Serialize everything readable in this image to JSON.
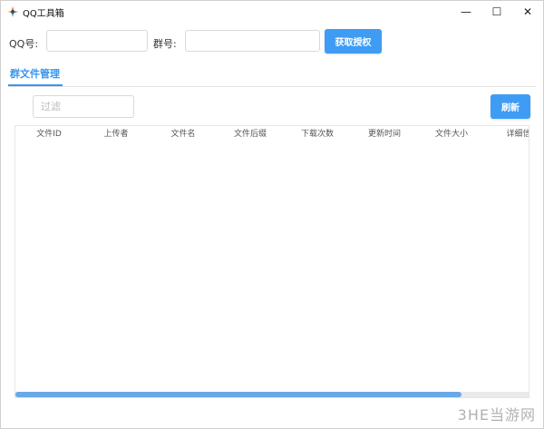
{
  "window": {
    "title": "QQ工具箱",
    "controls": {
      "minimize": "—",
      "maximize": "☐",
      "close": "✕"
    }
  },
  "form": {
    "qq_label": "QQ号:",
    "qq_value": "",
    "group_label": "群号:",
    "group_value": "",
    "auth_button": "获取授权"
  },
  "tabs": [
    {
      "label": "群文件管理",
      "active": true
    }
  ],
  "filter": {
    "placeholder": "过滤",
    "refresh_button": "刷新"
  },
  "table": {
    "columns": [
      "文件ID",
      "上传者",
      "文件名",
      "文件后缀",
      "下载次数",
      "更新时间",
      "文件大小",
      "详细信"
    ],
    "rows": [],
    "scroll_fraction": 0.87
  },
  "watermark": "3HE当游网",
  "colors": {
    "accent": "#3f9cf5",
    "tab_active": "#3a95f0",
    "scroll_thumb": "#6aa8e8"
  },
  "icons": {
    "app": "qq-toolbox-app-icon"
  }
}
